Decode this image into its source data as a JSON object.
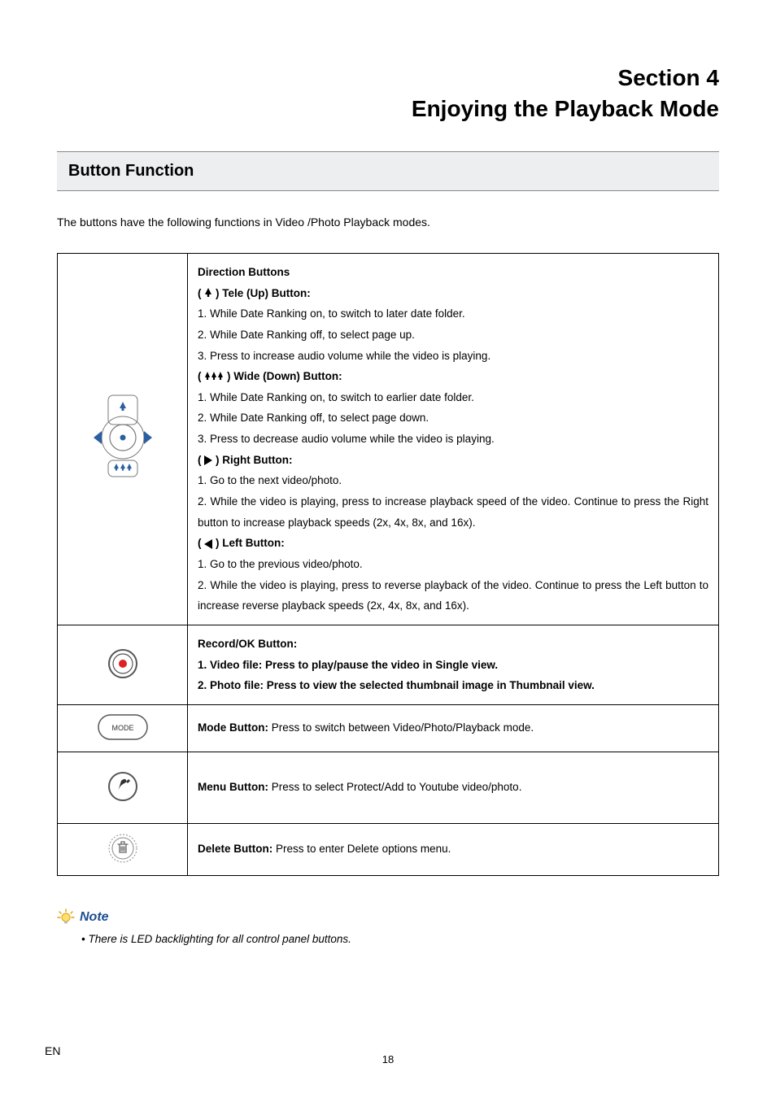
{
  "section_label": "Section 4",
  "section_title": "Enjoying the Playback Mode",
  "heading": "Button Function",
  "intro": "The buttons have the following functions in Video /Photo Playback modes.",
  "direction": {
    "header": "Direction Buttons",
    "tele": {
      "label_prefix": "( ",
      "label_suffix": " ) Tele (Up) Button:",
      "line1": "1. While Date Ranking on, to switch to later date folder.",
      "line2": "2. While Date Ranking off, to select page up.",
      "line3": "3. Press to increase audio volume while the video is playing."
    },
    "wide": {
      "label_prefix": "( ",
      "label_suffix": " ) Wide (Down) Button:",
      "line1": "1. While Date Ranking on, to switch to earlier date folder.",
      "line2": "2. While Date Ranking off, to select page down.",
      "line3": "3. Press to decrease audio volume while the video is playing."
    },
    "right": {
      "label_prefix": "( ",
      "label_suffix": " ) Right Button:",
      "line1": "1. Go to the next video/photo.",
      "line2": "2. While the video is playing, press to increase playback speed of the video. Continue to press the Right button to increase playback speeds (2x, 4x, 8x, and 16x)."
    },
    "left": {
      "label_prefix": "( ",
      "label_suffix": " ) Left Button:",
      "line1": "1. Go to the previous video/photo.",
      "line2": "2. While the video is playing, press to reverse playback of the video.  Continue to press the Left button to increase reverse playback speeds (2x, 4x, 8x, and 16x)."
    }
  },
  "record_ok": {
    "header": "Record/OK Button:",
    "line1": "1. Video file: Press to play/pause the video in Single view.",
    "line2": "2. Photo file: Press to view the selected thumbnail image in Thumbnail view."
  },
  "mode": {
    "label": "Mode Button: ",
    "desc": "Press to switch between Video/Photo/Playback mode."
  },
  "menu": {
    "label": "Menu Button: ",
    "desc": "Press to select Protect/Add to Youtube video/photo."
  },
  "delete": {
    "label": "Delete Button: ",
    "desc": "Press to enter Delete options menu."
  },
  "note_label": "Note",
  "note_bullet": "•  There is LED backlighting for all control panel buttons.",
  "footer_en": "EN",
  "footer_page": "18"
}
